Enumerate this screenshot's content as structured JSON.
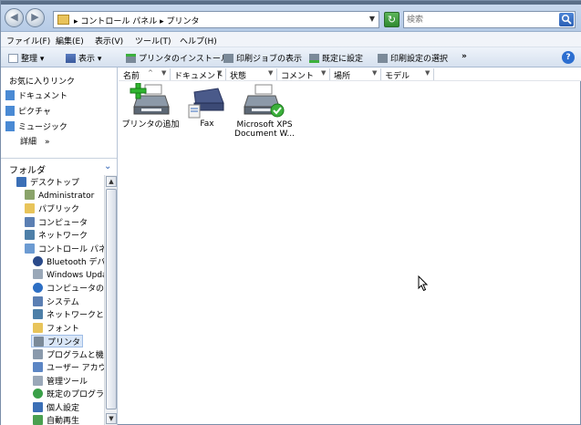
{
  "address": {
    "crumbs": "▸ コントロール パネル ▸ プリンタ",
    "dropdown_icon": "chevron-down-icon"
  },
  "search": {
    "placeholder": "検索"
  },
  "menu": [
    "ファイル(F)",
    "編集(E)",
    "表示(V)",
    "ツール(T)",
    "ヘルプ(H)"
  ],
  "toolbar": {
    "organize": "整理",
    "view": "表示",
    "install_printer": "プリンタのインストール",
    "see_print_jobs": "印刷ジョブの表示",
    "set_default": "既定に設定",
    "print_prefs": "印刷設定の選択",
    "more": "»",
    "help": "?"
  },
  "favorites": {
    "title": "お気に入りリンク",
    "items": [
      "ドキュメント",
      "ピクチャ",
      "ミュージック"
    ],
    "more": "詳細　»"
  },
  "folders": {
    "title": "フォルダ",
    "tree": [
      "デスクトップ",
      "Administrator",
      "パブリック",
      "コンピュータ",
      "ネットワーク",
      "コントロール パネル",
      "Bluetooth デバイ",
      "Windows Updat",
      "コンピュータの簡単",
      "システム",
      "ネットワークと共有",
      "フォント",
      "プリンタ",
      "プログラムと機能",
      "ユーザー アカウン",
      "管理ツール",
      "既定のプログラム",
      "個人設定",
      "自動再生"
    ]
  },
  "columns": [
    "名前",
    "ドキュメント",
    "状態",
    "コメント",
    "場所",
    "モデル"
  ],
  "printers": [
    {
      "line1": "プリンタの追加",
      "line2": ""
    },
    {
      "line1": "Fax",
      "line2": ""
    },
    {
      "line1": "Microsoft XPS",
      "line2": "Document W..."
    }
  ]
}
